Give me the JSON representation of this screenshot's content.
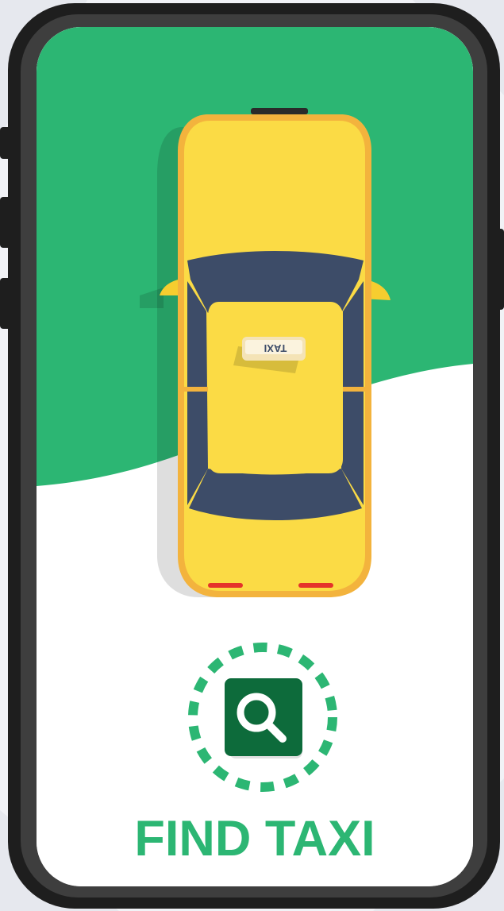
{
  "screen": {
    "top_background": "#2cb673",
    "bottom_background": "#ffffff"
  },
  "taxi_car": {
    "roof_sign": "TAXI",
    "body_color": "#fbdb45",
    "outline_color": "#f3b33d",
    "glass_color": "#3d4c68"
  },
  "search_action": {
    "icon": "search-icon",
    "tile_color": "#0d6b3b",
    "ring_color": "#2cb673",
    "label": "FIND TAXI",
    "label_color": "#2cb673"
  },
  "device": {
    "frame_color": "#1e1e1e",
    "bezel_color": "#3e3e3e"
  }
}
